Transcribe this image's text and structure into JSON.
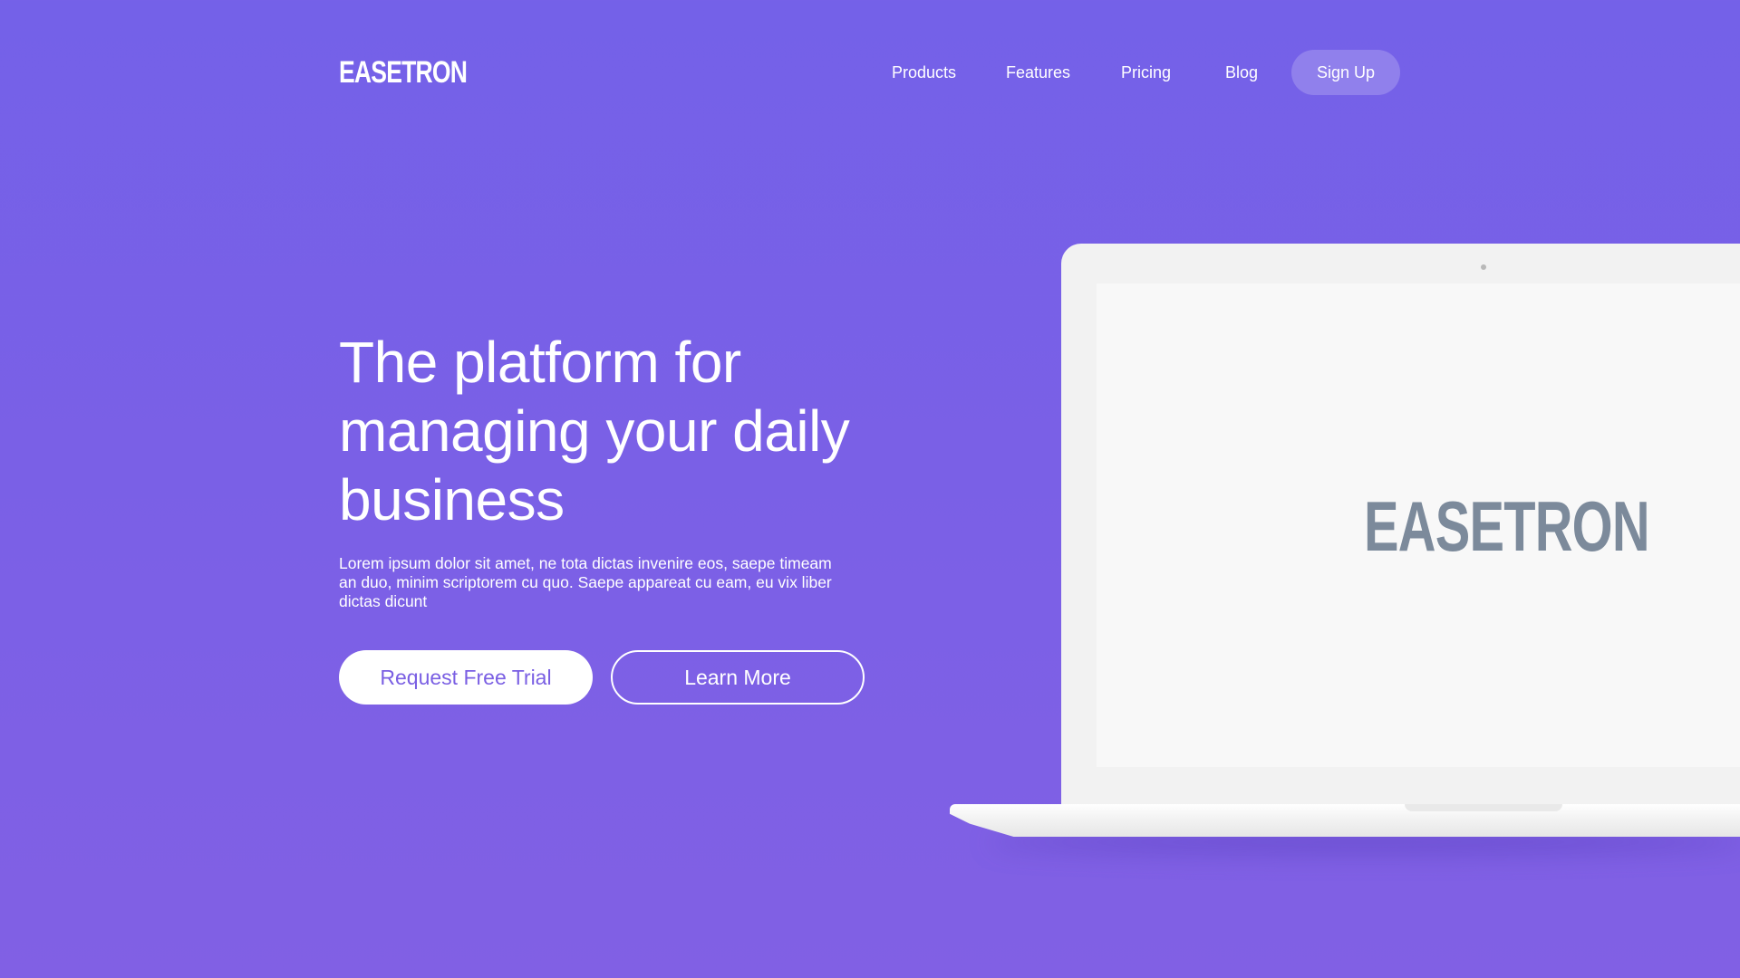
{
  "brand": {
    "logo_text": "EASETRON"
  },
  "nav": {
    "items": [
      {
        "label": "Products"
      },
      {
        "label": "Features"
      },
      {
        "label": "Pricing"
      },
      {
        "label": "Blog"
      }
    ],
    "signup_label": "Sign Up"
  },
  "hero": {
    "title": "The platform for managing your daily business",
    "description": "Lorem ipsum dolor sit amet, ne tota dictas invenire eos, saepe timeam an duo, minim scriptorem cu quo. Saepe appareat cu eam, eu vix liber dictas dicunt",
    "primary_cta": "Request Free Trial",
    "secondary_cta": "Learn More"
  },
  "laptop": {
    "screen_logo_text": "EASETRON"
  },
  "colors": {
    "background": "#7461E8",
    "accent_text": "#7A5FE3",
    "screen_logo": "#7C8A9B",
    "white": "#FFFFFF"
  }
}
